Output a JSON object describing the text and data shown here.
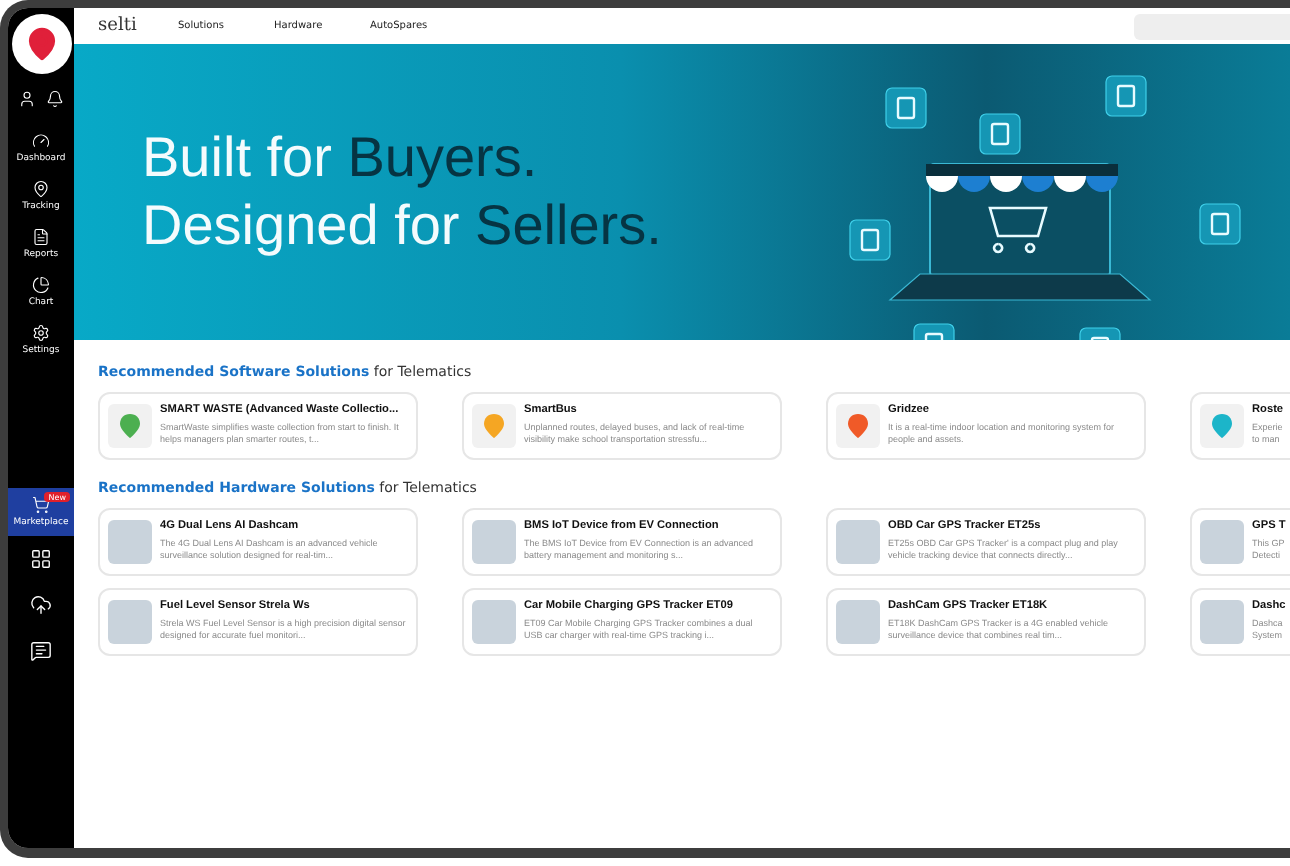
{
  "sidebar": {
    "items": [
      {
        "kind": "nav",
        "label": "Dashboard",
        "selected": false
      },
      {
        "kind": "nav",
        "label": "Tracking",
        "selected": false
      },
      {
        "kind": "nav",
        "label": "Reports",
        "selected": false
      },
      {
        "kind": "nav",
        "label": "Chart",
        "selected": false
      },
      {
        "kind": "nav",
        "label": "Settings",
        "selected": false
      },
      {
        "kind": "spacer"
      },
      {
        "kind": "nav",
        "label": "Marketplace",
        "badge": "New",
        "selected": true
      },
      {
        "kind": "icon",
        "selected": false
      },
      {
        "kind": "icon",
        "selected": false
      },
      {
        "kind": "icon",
        "selected": false
      }
    ]
  },
  "topbar": {
    "logo": "selti",
    "links": [
      "Solutions",
      "Hardware",
      "AutoSpares"
    ]
  },
  "hero": {
    "lines": [
      [
        {
          "text": "Built for ",
          "accent": false
        },
        {
          "text": "Buyers.",
          "accent": true
        }
      ],
      [
        {
          "text": "Designed for ",
          "accent": false
        },
        {
          "text": "Sellers.",
          "accent": true
        }
      ]
    ]
  },
  "sections": [
    {
      "title": [
        {
          "text": "Recommended Software Solutions",
          "accent": true
        },
        {
          "text": " for Telematics",
          "accent": false
        }
      ],
      "cards": [
        {
          "kind": "app",
          "color": "#4caf50",
          "title": "SMART WASTE (Advanced Waste Collectio...",
          "description": "SmartWaste simplifies waste collection from start to finish. It helps managers plan smarter routes, t..."
        },
        {
          "kind": "app",
          "color": "#f5a623",
          "title": "SmartBus",
          "description": "Unplanned routes, delayed buses, and lack of real-time visibility make school transportation stressfu..."
        },
        {
          "kind": "app",
          "color": "#f05a28",
          "title": "Gridzee",
          "description": "It is a real-time indoor location and monitoring system for people and assets."
        },
        {
          "kind": "app",
          "color": "#1cb5c9",
          "title": "Roste",
          "description": "Experie to man"
        }
      ]
    },
    {
      "title": [
        {
          "text": "Recommended Hardware Solutions",
          "accent": true
        },
        {
          "text": " for Telematics",
          "accent": false
        }
      ],
      "cards": [
        {
          "kind": "device",
          "title": "4G Dual Lens AI Dashcam",
          "description": "The 4G Dual Lens AI Dashcam is an advanced vehicle surveillance solution designed for real-tim..."
        },
        {
          "kind": "device",
          "title": "BMS IoT Device from EV Connection",
          "description": "The BMS IoT Device from EV Connection is an advanced battery management and monitoring s..."
        },
        {
          "kind": "device",
          "title": "OBD Car GPS Tracker ET25s",
          "description": "ET25s OBD Car GPS Tracker' is a compact plug and play vehicle tracking device that connects directly..."
        },
        {
          "kind": "device",
          "title": "GPS T",
          "description": "This GP Detecti"
        },
        {
          "kind": "device",
          "title": "Fuel Level Sensor Strela Ws",
          "description": "Strela WS Fuel Level Sensor is a high precision digital sensor designed for accurate fuel monitori..."
        },
        {
          "kind": "device",
          "title": "Car Mobile Charging GPS Tracker ET09",
          "description": "ET09 Car Mobile Charging GPS Tracker combines a dual USB car charger with real-time GPS tracking i..."
        },
        {
          "kind": "device",
          "title": "DashCam GPS Tracker ET18K",
          "description": "ET18K DashCam GPS Tracker is a 4G enabled vehicle surveillance device that combines real tim..."
        },
        {
          "kind": "device",
          "title": "Dashc",
          "description": "Dashca System"
        }
      ]
    }
  ]
}
